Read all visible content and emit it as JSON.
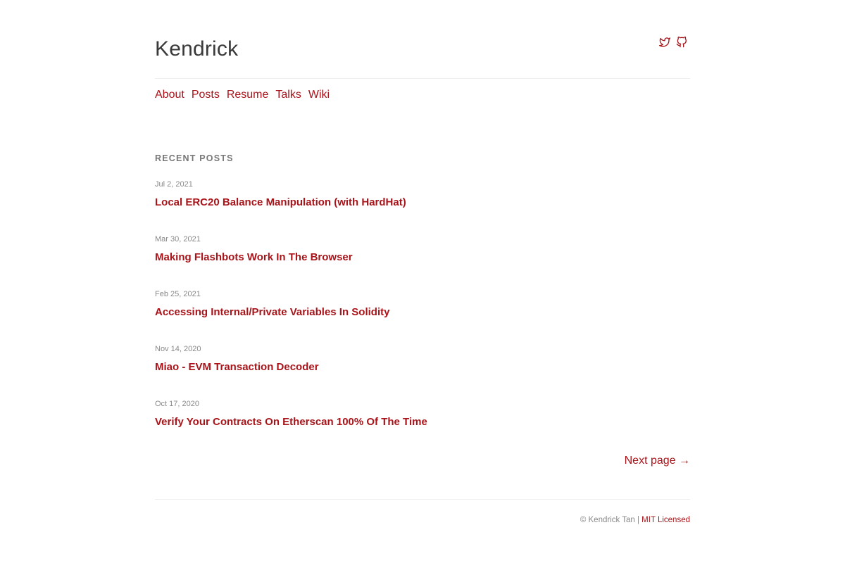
{
  "site": {
    "title": "Kendrick"
  },
  "social": {
    "twitter_icon": "twitter-bird-icon",
    "github_icon": "github-octocat-icon"
  },
  "nav": {
    "items": [
      {
        "label": "About"
      },
      {
        "label": "Posts"
      },
      {
        "label": "Resume"
      },
      {
        "label": "Talks"
      },
      {
        "label": "Wiki"
      }
    ]
  },
  "recent": {
    "heading": "RECENT POSTS",
    "posts": [
      {
        "date": "Jul 2, 2021",
        "title": "Local ERC20 Balance Manipulation (with HardHat)"
      },
      {
        "date": "Mar 30, 2021",
        "title": "Making Flashbots Work In The Browser"
      },
      {
        "date": "Feb 25, 2021",
        "title": "Accessing Internal/Private Variables In Solidity"
      },
      {
        "date": "Nov 14, 2020",
        "title": "Miao - EVM Transaction Decoder"
      },
      {
        "date": "Oct 17, 2020",
        "title": "Verify Your Contracts On Etherscan 100% Of The Time"
      }
    ]
  },
  "pagination": {
    "next_label": "Next page →"
  },
  "footer": {
    "copyright": "© Kendrick Tan |",
    "license_link": "MIT Licensed"
  },
  "colors": {
    "accent": "#a8141a",
    "text": "#333333",
    "muted": "#888888",
    "rule": "#eeeeee"
  }
}
